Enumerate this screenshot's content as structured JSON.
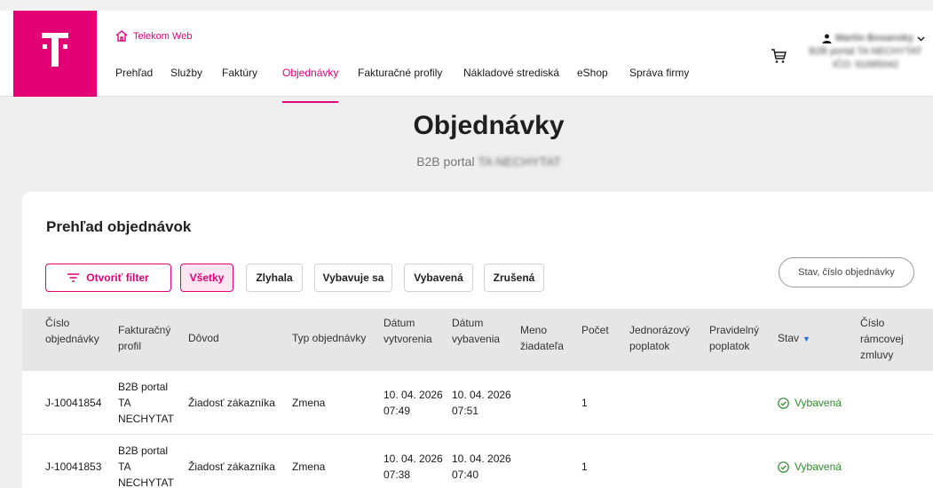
{
  "header": {
    "home_link": "Telekom Web",
    "nav": [
      "Prehľad",
      "Služby",
      "Faktúry",
      "Objednávky",
      "Fakturačné profily",
      "Nákladové strediská",
      "eShop",
      "Správa firmy"
    ],
    "active_nav": "Objednávky",
    "user_name": "Martin Bosansky",
    "user_portal": "B2B portal TA NECHYTAT",
    "user_ico": "IČO: 91685042"
  },
  "page": {
    "title": "Objednávky",
    "subtitle_prefix": "B2B portal",
    "subtitle_blurred": "TA NECHYTAT"
  },
  "orders": {
    "title": "Prehľad objednávok",
    "filter_button": "Otvoriť filter",
    "status_tabs": [
      "Všetky",
      "Zlyhala",
      "Vybavuje sa",
      "Vybavená",
      "Zrušená"
    ],
    "search_placeholder": "Stav, číslo objednávky",
    "columns": [
      [
        "Číslo",
        "objednávky"
      ],
      [
        "Fakturačný",
        "profil"
      ],
      [
        "Dôvod"
      ],
      [
        "Typ objednávky"
      ],
      [
        "Dátum",
        "vytvorenia"
      ],
      [
        "Dátum",
        "vybavenia"
      ],
      [
        "Meno",
        "žiadateľa"
      ],
      [
        "Počet"
      ],
      [
        "Jednorázový",
        "poplatok"
      ],
      [
        "Pravidelný",
        "poplatok"
      ],
      [
        "Stav"
      ],
      [
        "Číslo",
        "rámcovej",
        "zmluvy"
      ]
    ],
    "rows": [
      {
        "id": "J-10041854",
        "profile": [
          "B2B portal",
          "TA",
          "NECHYTAT"
        ],
        "reason": "Žiadosť zákazníka",
        "type": "Zmena",
        "created": [
          "10. 04. 2026",
          "07:49"
        ],
        "completed": [
          "10. 04. 2026",
          "07:51"
        ],
        "requester": "",
        "count": "1",
        "one_time_fee": "",
        "recurring_fee": "",
        "status": "Vybavená",
        "contract": ""
      },
      {
        "id": "J-10041853",
        "profile": [
          "B2B portal",
          "TA",
          "NECHYTAT"
        ],
        "reason": "Žiadosť zákazníka",
        "type": "Zmena",
        "created": [
          "10. 04. 2026",
          "07:38"
        ],
        "completed": [
          "10. 04. 2026",
          "07:40"
        ],
        "requester": "",
        "count": "1",
        "one_time_fee": "",
        "recurring_fee": "",
        "status": "Vybavená",
        "contract": ""
      }
    ]
  },
  "colors": {
    "brand": "#e20074",
    "status_done": "#2d8a2d",
    "sort_arrow": "#2a6fe0"
  },
  "icons": [
    "home-icon",
    "cart-icon",
    "user-icon",
    "chevron-down-icon",
    "filter-icon",
    "check-circle-icon",
    "sort-down-icon"
  ]
}
